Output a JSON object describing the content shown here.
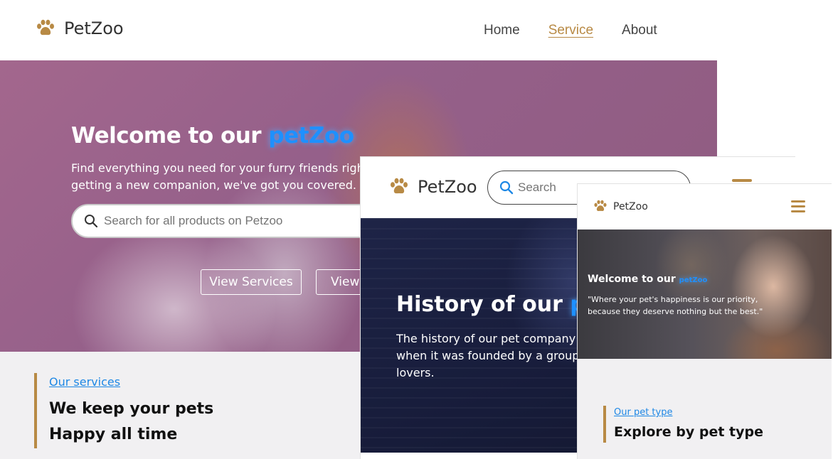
{
  "colors": {
    "accent_gold": "#b88a45",
    "accent_blue": "#1e90ff",
    "link_blue": "#1e88e5"
  },
  "desktop": {
    "brand": "PetZoo",
    "nav": [
      {
        "label": "Home",
        "active": false
      },
      {
        "label": "Service",
        "active": true
      },
      {
        "label": "About",
        "active": false
      }
    ],
    "hero": {
      "title_prefix": "Welcome to our ",
      "title_accent": "petZoo",
      "subtitle_line1": "Find everything you need for your furry friends right her",
      "subtitle_line2": "getting a new companion, we've got you covered.",
      "search_placeholder": "Search for all products on Petzoo",
      "button1": "View Services",
      "button2": "View"
    },
    "section": {
      "link": "Our services",
      "title_line1": "We keep your pets",
      "title_line2": "Happy all time"
    }
  },
  "tablet": {
    "brand": "PetZoo",
    "search_placeholder": "Search",
    "hero": {
      "title_prefix": "History of our ",
      "title_accent": "pe",
      "text_line1": "The history of our pet company da",
      "text_line2": "when it was founded by a group o",
      "text_line3": "lovers."
    }
  },
  "mobile": {
    "brand": "PetZoo",
    "hero": {
      "title_prefix": "Welcome to our ",
      "title_accent": "petZoo",
      "quote": "\"Where your pet's happiness is our priority, because they deserve nothing but the best.\""
    },
    "section": {
      "link": "Our pet type",
      "title": "Explore by pet type"
    }
  }
}
